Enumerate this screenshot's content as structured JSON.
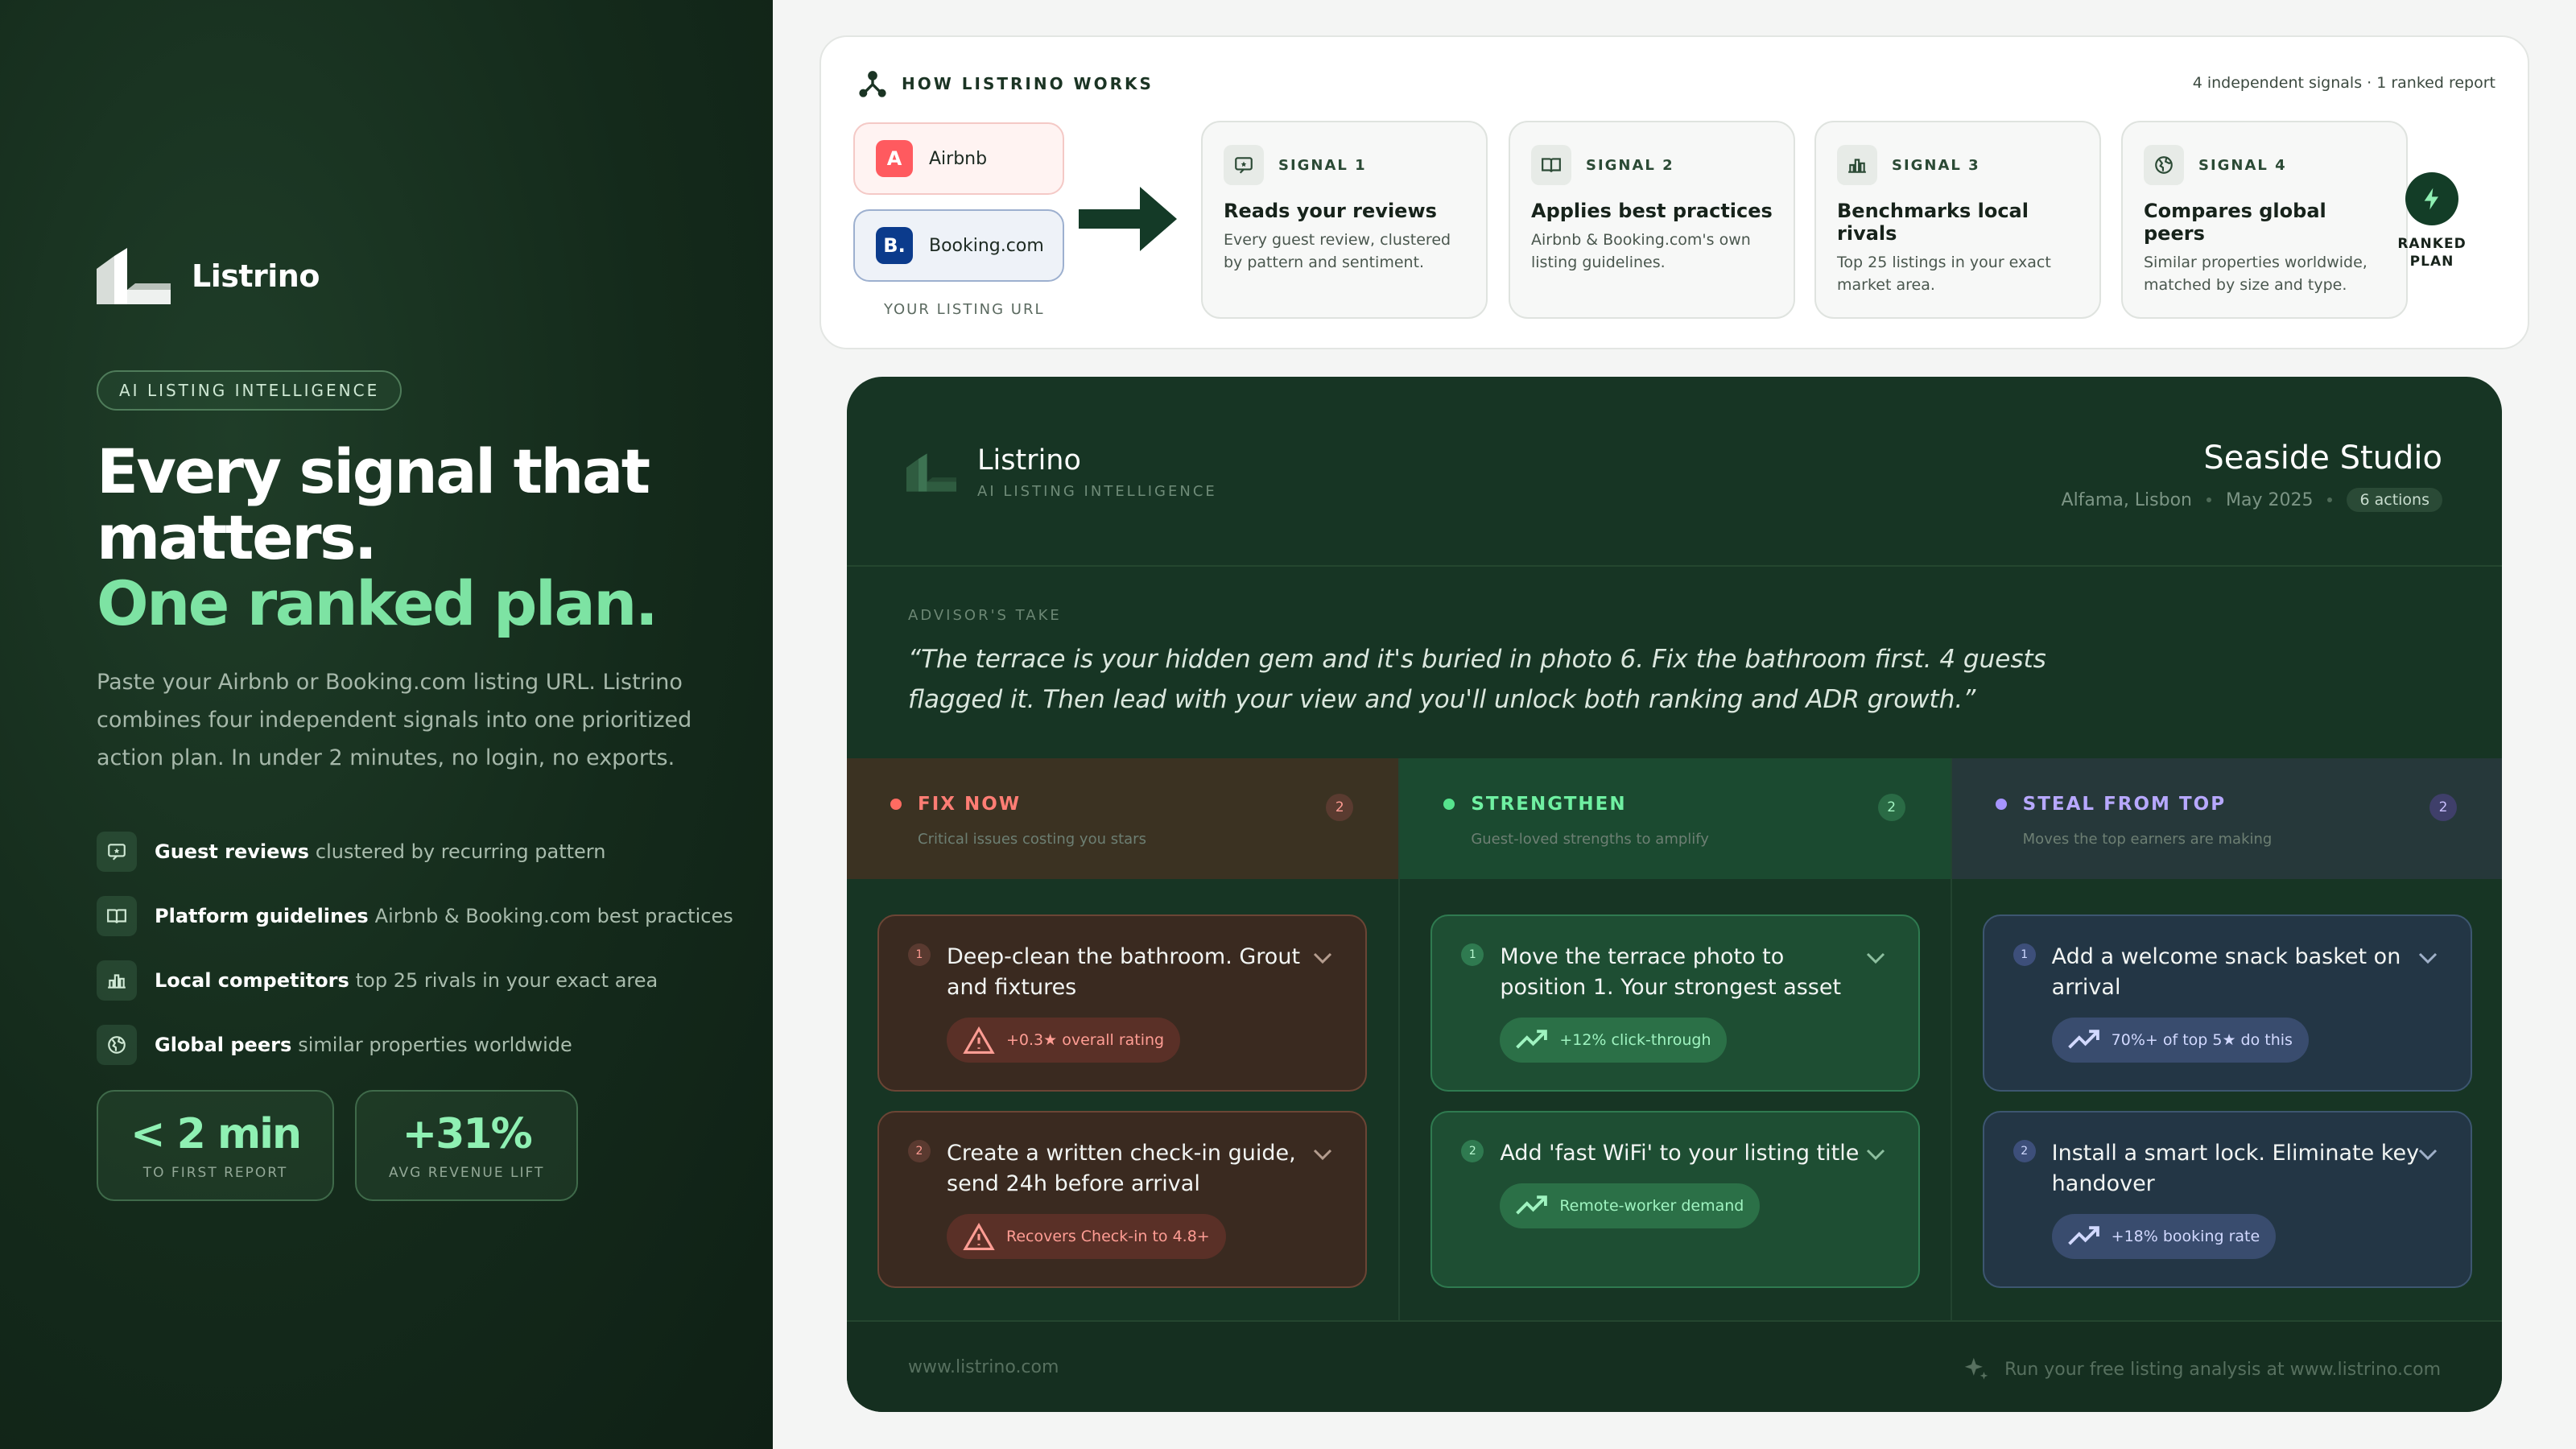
{
  "left": {
    "brand_name": "Listrino",
    "pill": "AI LISTING INTELLIGENCE",
    "headline_1": "Every signal that",
    "headline_2": "matters.",
    "headline_3": "One ranked plan.",
    "lede": "Paste your Airbnb or Booking.com listing URL. Listrino combines four independent signals into one prioritized action plan. In under 2 minutes, no login, no exports.",
    "features": [
      {
        "icon": "review-icon",
        "bold": "Guest reviews",
        "desc": "clustered by recurring pattern"
      },
      {
        "icon": "book-icon",
        "bold": "Platform guidelines",
        "desc": "Airbnb & Booking.com best practices"
      },
      {
        "icon": "bar-chart-icon",
        "bold": "Local competitors",
        "desc": "top 25 rivals in your exact area"
      },
      {
        "icon": "globe-icon",
        "bold": "Global peers",
        "desc": "similar properties worldwide"
      }
    ],
    "stats": [
      {
        "value": "< 2 min",
        "label": "TO FIRST REPORT"
      },
      {
        "value": "+31%",
        "label": "AVG REVENUE LIFT"
      }
    ]
  },
  "how": {
    "title": "HOW LISTRINO WORKS",
    "meta": "4 independent signals · 1 ranked report",
    "sources": [
      {
        "logo": "A",
        "name": "Airbnb",
        "color": "#ff5a5f"
      },
      {
        "logo": "B.",
        "name": "Booking.com",
        "color": "#0b3b8c"
      }
    ],
    "source_label": "YOUR LISTING URL",
    "signals": [
      {
        "num": "SIGNAL 1",
        "title": "Reads your reviews",
        "desc": "Every guest review, clustered by pattern and sentiment."
      },
      {
        "num": "SIGNAL 2",
        "title": "Applies best practices",
        "desc": "Airbnb & Booking.com's own listing guidelines."
      },
      {
        "num": "SIGNAL 3",
        "title": "Benchmarks local rivals",
        "desc": "Top 25 listings in your exact market area."
      },
      {
        "num": "SIGNAL 4",
        "title": "Compares global peers",
        "desc": "Similar properties worldwide, matched by size and type."
      }
    ],
    "ranked_1": "RANKED",
    "ranked_2": "PLAN"
  },
  "report": {
    "brand_name": "Listrino",
    "brand_sub": "AI LISTING INTELLIGENCE",
    "property_title": "Seaside Studio",
    "location": "Alfama, Lisbon",
    "date": "May 2025",
    "actions_badge": "6 actions",
    "advisor_label": "ADVISOR'S TAKE",
    "advisor_quote": "“The terrace is your hidden gem and it's buried in photo 6. Fix the bathroom first. 4 guests flagged it. Then lead with your view and you'll unlock both ranking and ADR growth.”",
    "columns": [
      {
        "title": "FIX NOW",
        "subtitle": "Critical issues costing you stars",
        "count": "2",
        "cards": [
          {
            "num": "1",
            "text": "Deep-clean the bathroom. Grout and fixtures",
            "tag": "+0.3★ overall rating"
          },
          {
            "num": "2",
            "text": "Create a written check-in guide, send 24h before arrival",
            "tag": "Recovers Check-in to 4.8+"
          }
        ]
      },
      {
        "title": "STRENGTHEN",
        "subtitle": "Guest-loved strengths to amplify",
        "count": "2",
        "cards": [
          {
            "num": "1",
            "text": "Move the terrace photo to position 1. Your strongest asset",
            "tag": "+12% click-through"
          },
          {
            "num": "2",
            "text": "Add 'fast WiFi' to your listing title",
            "tag": "Remote-worker demand"
          }
        ]
      },
      {
        "title": "STEAL FROM TOP",
        "subtitle": "Moves the top earners are making",
        "count": "2",
        "cards": [
          {
            "num": "1",
            "text": "Add a welcome snack basket on arrival",
            "tag": "70%+ of top 5★ do this"
          },
          {
            "num": "2",
            "text": "Install a smart lock. Eliminate key handover",
            "tag": "+18% booking rate"
          }
        ]
      }
    ],
    "footer_url": "www.listrino.com",
    "footer_cta": "Run your free listing analysis at www.listrino.com"
  }
}
